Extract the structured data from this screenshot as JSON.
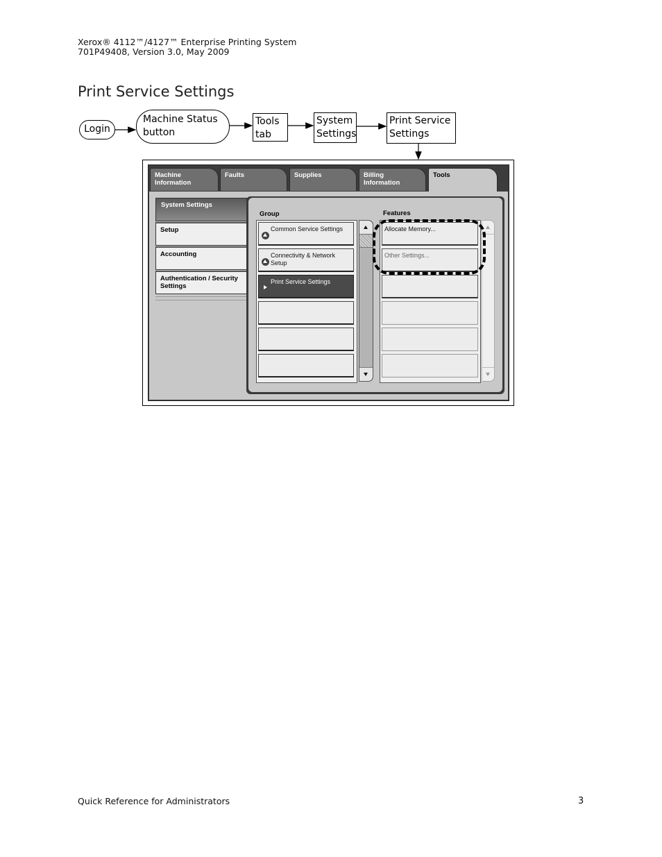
{
  "header": {
    "line1": "Xerox® 4112™/4127™ Enterprise Printing System",
    "line2": "701P49408, Version 3.0, May 2009"
  },
  "section_title": "Print Service Settings",
  "flow": {
    "steps": [
      {
        "label": "Login",
        "shape": "rounded"
      },
      {
        "label": "Machine Status button",
        "shape": "rounded"
      },
      {
        "label": "Tools tab",
        "shape": "box"
      },
      {
        "label": "System Settings",
        "shape": "box"
      },
      {
        "label": "Print Service Settings",
        "shape": "box"
      }
    ]
  },
  "ui": {
    "tabs": [
      {
        "label": "Machine Information",
        "active": false
      },
      {
        "label": "Faults",
        "active": false
      },
      {
        "label": "Supplies",
        "active": false
      },
      {
        "label": "Billing Information",
        "active": false
      },
      {
        "label": "Tools",
        "active": true
      }
    ],
    "sidebar": {
      "header": "System Settings",
      "items": [
        {
          "label": "Setup"
        },
        {
          "label": "Accounting"
        },
        {
          "label": "Authentication / Security Settings"
        }
      ]
    },
    "group": {
      "label": "Group",
      "items": [
        {
          "label": "Common Service Settings",
          "icon": "expand-up-icon",
          "selected": false
        },
        {
          "label": "Connectivity & Network Setup",
          "icon": "expand-up-icon",
          "selected": false
        },
        {
          "label": "Print Service Settings",
          "icon": "play-arrow-icon",
          "selected": true
        },
        {
          "label": ""
        },
        {
          "label": ""
        },
        {
          "label": ""
        }
      ]
    },
    "features": {
      "label": "Features",
      "items": [
        {
          "label": "Allocate Memory...",
          "enabled": true
        },
        {
          "label": "Other Settings...",
          "enabled": false
        },
        {
          "label": ""
        },
        {
          "label": ""
        },
        {
          "label": ""
        },
        {
          "label": ""
        }
      ]
    }
  },
  "footer": {
    "doc_title": "Quick Reference for Administrators",
    "page_number": "3"
  }
}
